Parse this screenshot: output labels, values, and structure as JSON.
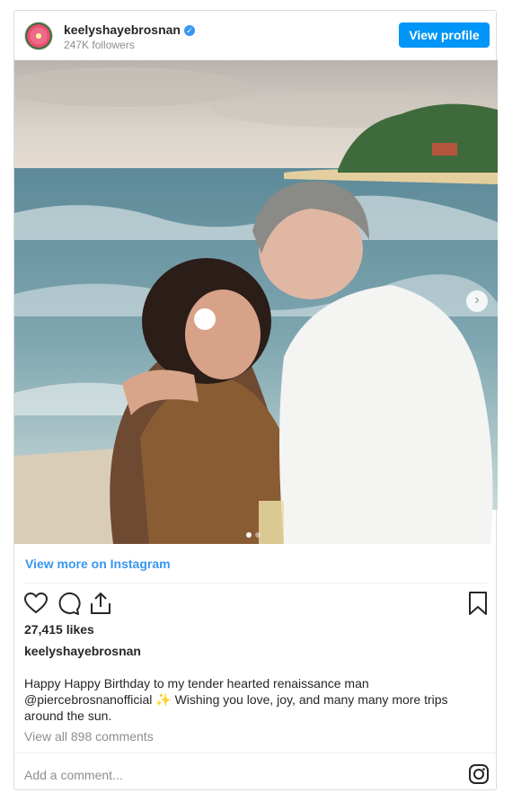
{
  "header": {
    "username": "keelyshayebrosnan",
    "verified_mark": "✓",
    "followers": "247K followers",
    "view_profile_label": "View profile"
  },
  "post": {
    "image_alt": "Couple kissing on a beach by the ocean",
    "carousel_next_glyph": "›",
    "carousel": {
      "total": 2,
      "current": 1
    }
  },
  "view_more_label": "View more on Instagram",
  "icons": [
    "heart-icon",
    "comment-icon",
    "share-icon",
    "bookmark-icon",
    "instagram-icon"
  ],
  "likes": "27,415 likes",
  "caption": {
    "username": "keelyshayebrosnan",
    "text": "Happy Happy Birthday to my tender hearted renaissance man @piercebrosnanofficial ✨ Wishing you love, joy, and many many more trips around the sun."
  },
  "comments_link": "View all 898 comments",
  "add_comment_placeholder": "Add a comment...",
  "colors": {
    "accent": "#0095f6",
    "link": "#3897f0",
    "text": "#262626",
    "muted": "#8e8e8e"
  }
}
